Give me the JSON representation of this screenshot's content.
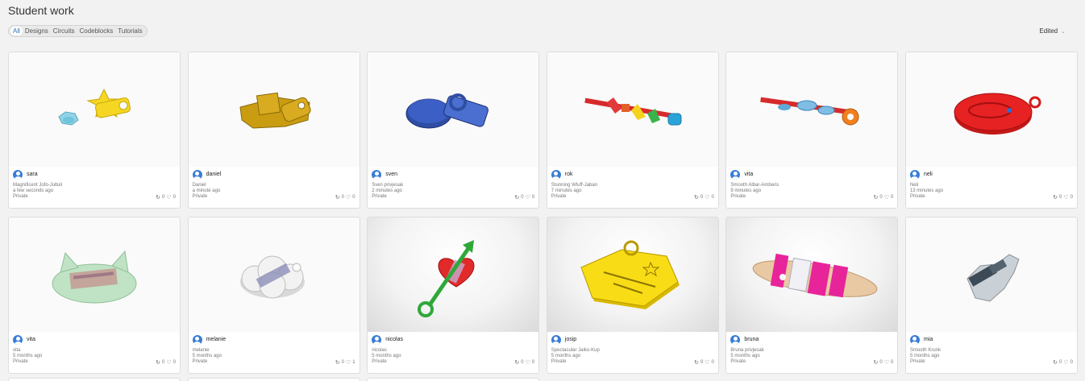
{
  "page": {
    "title": "Student work"
  },
  "filters": {
    "tabs": [
      "All",
      "Designs",
      "Circuits",
      "Codeblocks",
      "Tutorials"
    ],
    "active": "All"
  },
  "sort": {
    "label": "Edited"
  },
  "colors": {
    "accent": "#2b6fb8",
    "avatar": "#3a7dd6"
  },
  "cards": [
    {
      "user": "sara",
      "design": "Magnificent Jofo-Jultuli",
      "time": "a few seconds ago",
      "privacy": "Private",
      "copies": "0",
      "likes": "0"
    },
    {
      "user": "daniel",
      "design": "Daniel",
      "time": "a minute ago",
      "privacy": "Private",
      "copies": "0",
      "likes": "0"
    },
    {
      "user": "sven",
      "design": "Sven privjesak",
      "time": "2 minutes ago",
      "privacy": "Private",
      "copies": "0",
      "likes": "0"
    },
    {
      "user": "rok",
      "design": "Stunning Wluff-Jaban",
      "time": "7 minutes ago",
      "privacy": "Private",
      "copies": "0",
      "likes": "0"
    },
    {
      "user": "vita",
      "design": "Smooth Albar-Amberis",
      "time": "9 minutes ago",
      "privacy": "Private",
      "copies": "0",
      "likes": "0"
    },
    {
      "user": "neli",
      "design": "Neli",
      "time": "13 minutes ago",
      "privacy": "Private",
      "copies": "0",
      "likes": "0"
    },
    {
      "user": "vita",
      "design": "vita",
      "time": "5 months ago",
      "privacy": "Private",
      "copies": "0",
      "likes": "0"
    },
    {
      "user": "melanie",
      "design": "melanie",
      "time": "5 months ago",
      "privacy": "Private",
      "copies": "0",
      "likes": "1"
    },
    {
      "user": "nicolas",
      "design": "nicolas",
      "time": "5 months ago",
      "privacy": "Private",
      "copies": "0",
      "likes": "0"
    },
    {
      "user": "josip",
      "design": "Spectacular Jaiko-Kup",
      "time": "5 months ago",
      "privacy": "Private",
      "copies": "0",
      "likes": "0"
    },
    {
      "user": "bruna",
      "design": "Bruna privjesak",
      "time": "5 months ago",
      "privacy": "Private",
      "copies": "0",
      "likes": "0"
    },
    {
      "user": "mia",
      "design": "Smooth Krunk",
      "time": "5 months ago",
      "privacy": "Private",
      "copies": "0",
      "likes": "0"
    }
  ]
}
